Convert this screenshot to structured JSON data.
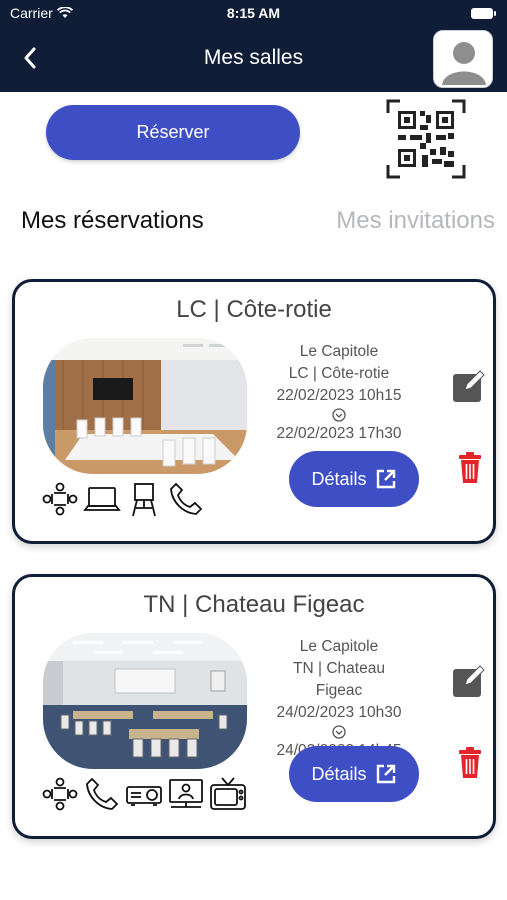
{
  "status_bar": {
    "carrier": "Carrier",
    "time": "8:15 AM"
  },
  "header": {
    "title": "Mes salles"
  },
  "actions": {
    "reserve_label": "Réserver"
  },
  "tabs": [
    {
      "label": "Mes réservations",
      "active": true
    },
    {
      "label": "Mes invitations",
      "active": false
    }
  ],
  "reservations": [
    {
      "title": "LC | Côte-rotie",
      "building": "Le Capitole",
      "room": "LC | Côte-rotie",
      "start": "22/02/2023 10h15",
      "end": "22/02/2023 17h30",
      "details_label": "Détails",
      "equipment": [
        "meeting-people-icon",
        "laptop-icon",
        "flipchart-icon",
        "phone-icon"
      ]
    },
    {
      "title": "TN | Chateau Figeac",
      "building": "Le Capitole",
      "room": "TN | Chateau Figeac",
      "start": "24/02/2023 10h30",
      "end": "24/02/2023 14h45",
      "details_label": "Détails",
      "equipment": [
        "meeting-people-icon",
        "phone-icon",
        "projector-icon",
        "videoconference-icon",
        "tv-icon"
      ]
    }
  ],
  "colors": {
    "header_bg": "#0f1d37",
    "accent": "#3e4fc6",
    "delete": "#e3242b",
    "card_border": "#0f1d37"
  }
}
